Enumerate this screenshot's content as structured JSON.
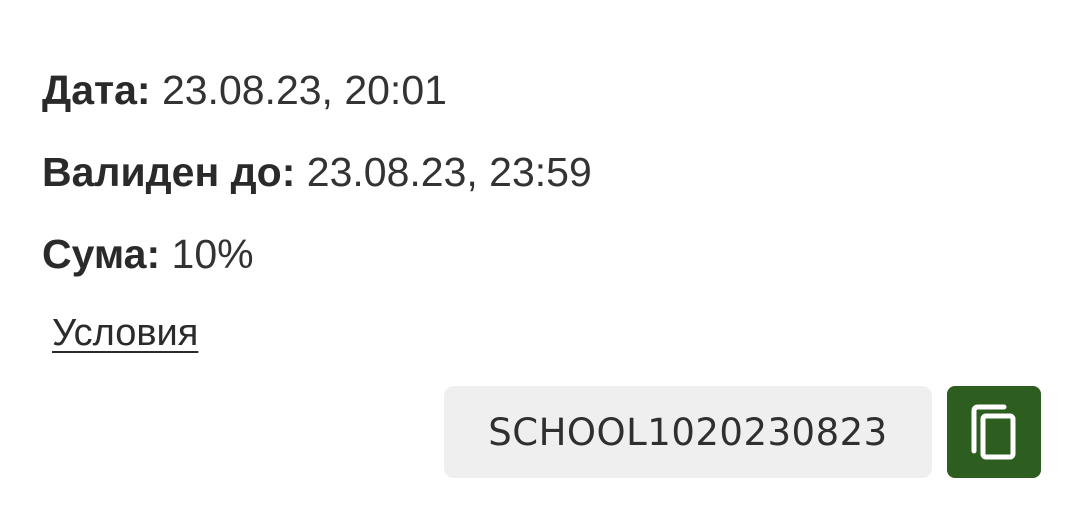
{
  "voucher": {
    "date_label": "Дата:",
    "date_value": "23.08.23, 20:01",
    "valid_label": "Валиден до:",
    "valid_value": "23.08.23, 23:59",
    "amount_label": "Сума:",
    "amount_value": "10%",
    "terms_link": "Условия",
    "code": "SCHOOL1020230823"
  },
  "copy_button": {
    "icon": "copy-icon",
    "color": "#2d5d1f"
  },
  "code_box_color": "#efefef"
}
